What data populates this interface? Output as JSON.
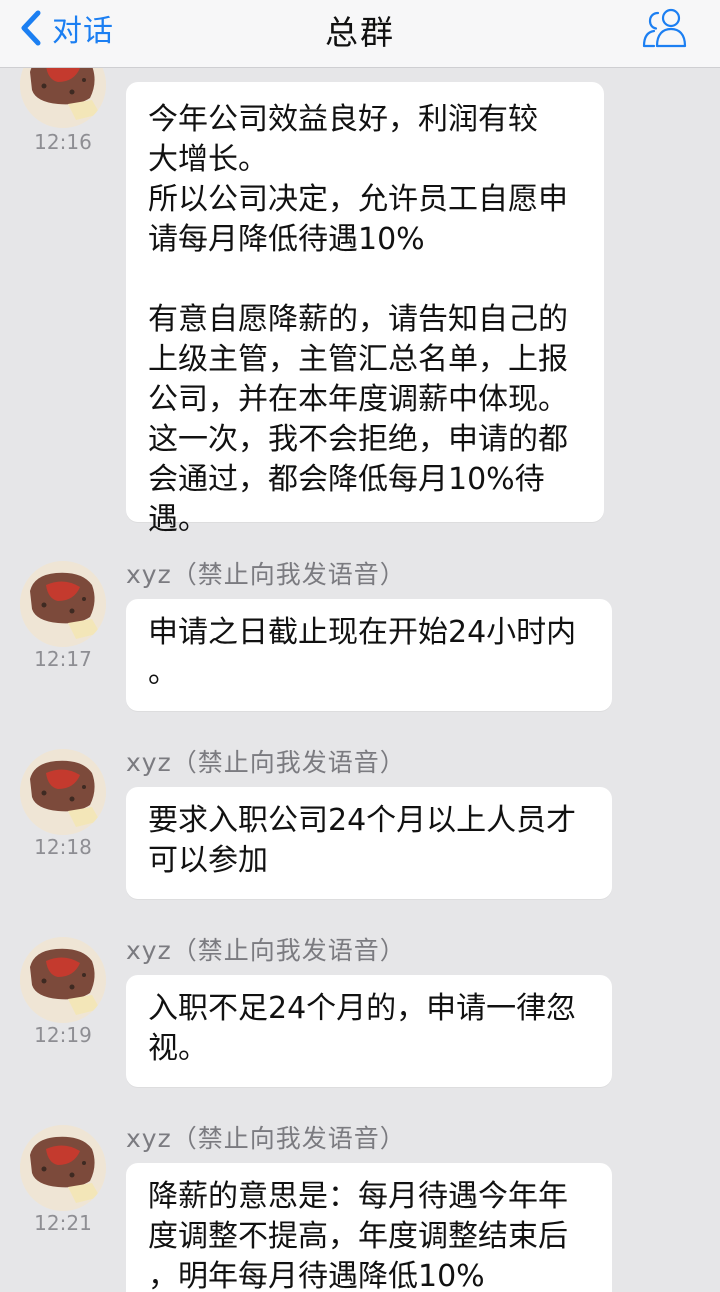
{
  "navbar": {
    "back_label": "对话",
    "title": "总群"
  },
  "messages": [
    {
      "time": "12:16",
      "sender": "",
      "text": "今年公司效益良好，利润有较\n大增长。\n所以公司决定，允许员工自愿申\n请每月降低待遇10%\n\n有意自愿降薪的，请告知自己的\n上级主管，主管汇总名单，上报\n公司，并在本年度调薪中体现。\n这一次，我不会拒绝，申请的都\n会通过，都会降低每月10%待\n遇。"
    },
    {
      "time": "12:17",
      "sender": "xyz（禁止向我发语音）",
      "text": "申请之日截止现在开始24小时内\n。"
    },
    {
      "time": "12:18",
      "sender": "xyz（禁止向我发语音）",
      "text": "要求入职公司24个月以上人员才\n可以参加"
    },
    {
      "time": "12:19",
      "sender": "xyz（禁止向我发语音）",
      "text": "入职不足24个月的，申请一律忽\n视。"
    },
    {
      "time": "12:21",
      "sender": "xyz（禁止向我发语音）",
      "text": "降薪的意思是：每月待遇今年年\n度调整不提高，年度调整结束后\n，明年每月待遇降低10%"
    }
  ],
  "colors": {
    "accent": "#1c7ff2",
    "background": "#e6e6e8",
    "bubble": "#ffffff"
  },
  "icons": {
    "back": "chevron-left-icon",
    "members": "group-members-icon"
  }
}
